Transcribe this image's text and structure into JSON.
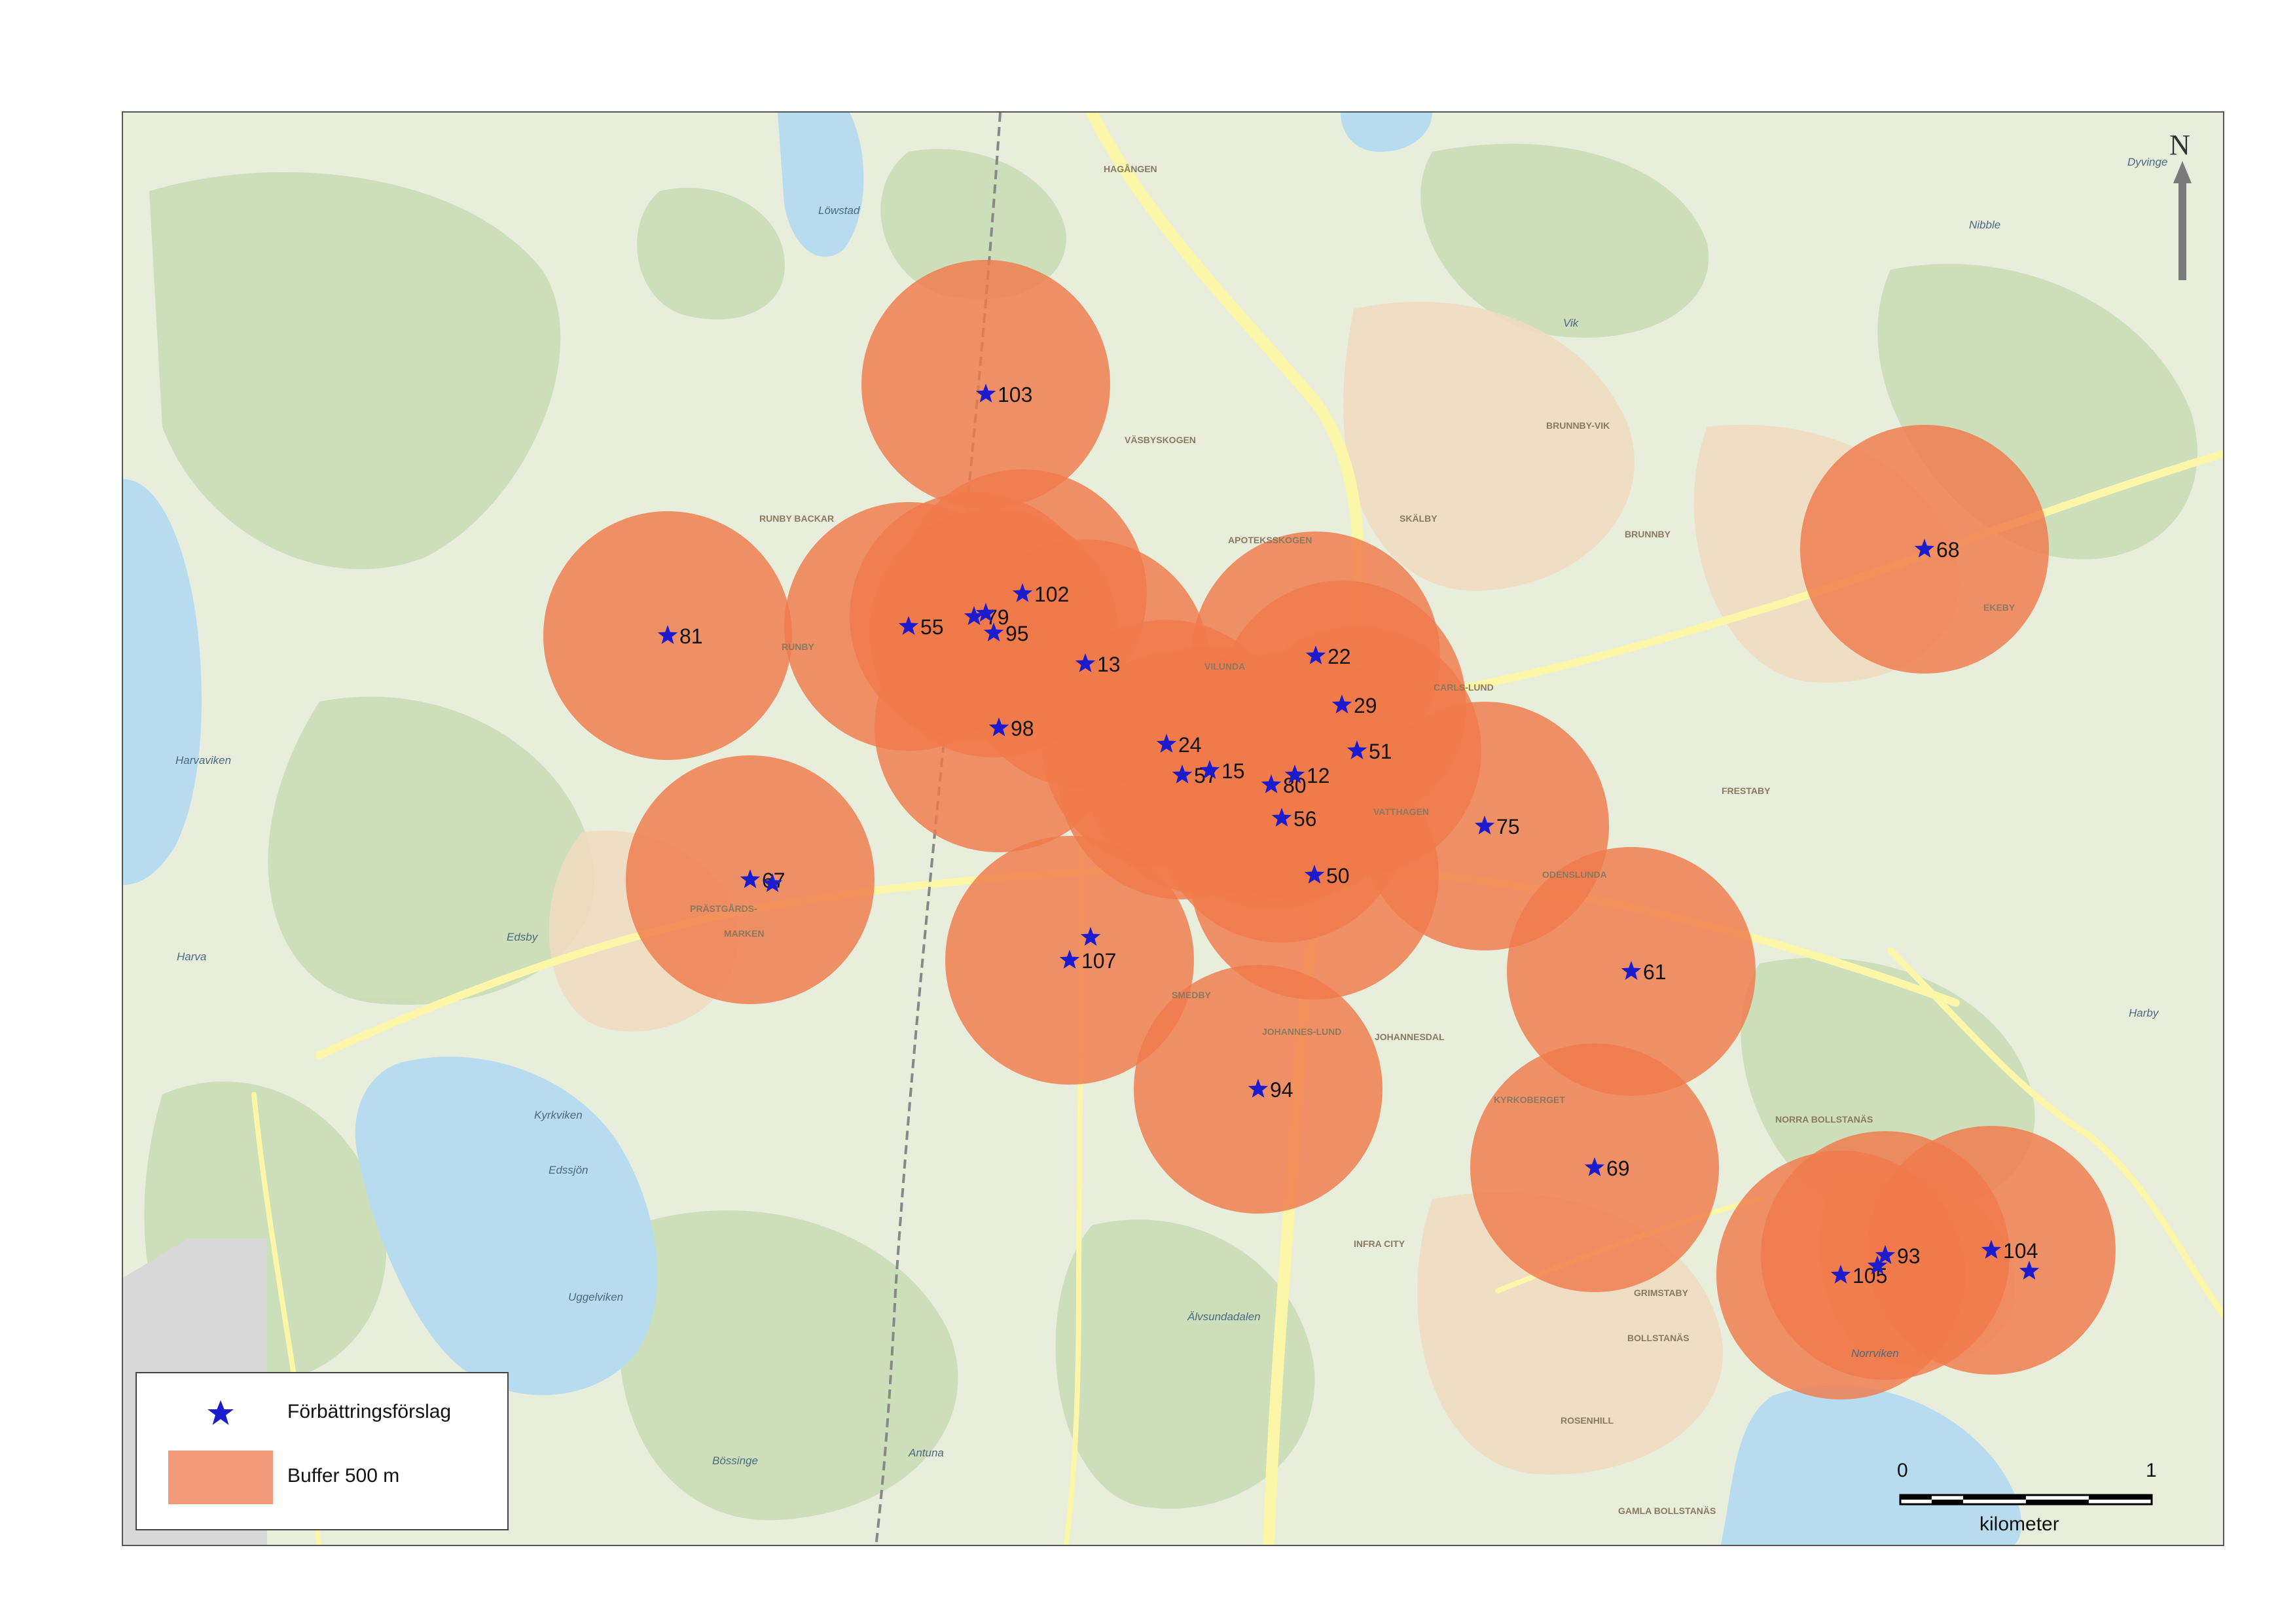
{
  "map": {
    "place_labels": [
      "HAGÅNGEN",
      "VÄSBYSKOGEN",
      "RUNBY BACKAR",
      "RUNBY",
      "APOTEKSSKOGEN",
      "VILUNDA",
      "SKÄLBY",
      "BRUNNBY",
      "BRUNNBY-VIK",
      "CARLS-LUND",
      "EKEBY",
      "FRESTABY",
      "VATTHAGEN",
      "ODENSLUNDA",
      "PRÄSTGÅRDS-",
      "MARKEN",
      "SMEDBY",
      "JOHANNES-LUND",
      "JOHANNESDAL",
      "KYRKOBERGET",
      "NORRA BOLLSTANÄS",
      "GRIMSTABY",
      "BOLLSTANÄS",
      "ROSENHILL",
      "GAMLA BOLLSTANÄS",
      "INFRA CITY",
      "Edssjön",
      "Harva",
      "Edsby",
      "Nibble",
      "Vik",
      "Löwstad",
      "Dyvinge",
      "Harby",
      "Kyrkviken",
      "Norrviken",
      "Uggelviken",
      "Älvsundadalen",
      "Bössinge",
      "Antuna",
      "Harvaviken"
    ],
    "buffers": [
      {
        "id": "103"
      },
      {
        "id": "55"
      },
      {
        "id": "102"
      },
      {
        "id": "95"
      },
      {
        "id": "79"
      },
      {
        "id": "13"
      },
      {
        "id": "98"
      },
      {
        "id": "81"
      },
      {
        "id": "67"
      },
      {
        "id": "107"
      },
      {
        "id": "22"
      },
      {
        "id": "29"
      },
      {
        "id": "24"
      },
      {
        "id": "57"
      },
      {
        "id": "15"
      },
      {
        "id": "80"
      },
      {
        "id": "12"
      },
      {
        "id": "56"
      },
      {
        "id": "51"
      },
      {
        "id": "50"
      },
      {
        "id": "75"
      },
      {
        "id": "61"
      },
      {
        "id": "69"
      },
      {
        "id": "94"
      },
      {
        "id": "68"
      },
      {
        "id": "93"
      },
      {
        "id": "105"
      },
      {
        "id": "104"
      }
    ],
    "markers": [
      {
        "label": "103"
      },
      {
        "label": "102"
      },
      {
        "label": "55"
      },
      {
        "label": "95"
      },
      {
        "label": "79"
      },
      {
        "label": "13"
      },
      {
        "label": "98"
      },
      {
        "label": "81"
      },
      {
        "label": "67"
      },
      {
        "label": "107"
      },
      {
        "label": "24"
      },
      {
        "label": "57"
      },
      {
        "label": "15"
      },
      {
        "label": "80"
      },
      {
        "label": "12"
      },
      {
        "label": "56"
      },
      {
        "label": "22"
      },
      {
        "label": "29"
      },
      {
        "label": "51"
      },
      {
        "label": "50"
      },
      {
        "label": "75"
      },
      {
        "label": "61"
      },
      {
        "label": "69"
      },
      {
        "label": "94"
      },
      {
        "label": "68"
      },
      {
        "label": "93"
      },
      {
        "label": "105"
      },
      {
        "label": "104"
      },
      {
        "label": ""
      },
      {
        "label": ""
      },
      {
        "label": ""
      },
      {
        "label": ""
      },
      {
        "label": ""
      }
    ],
    "colors": {
      "land": "#e8eddc",
      "forest": "#c9dcb6",
      "water": "#b8dcef",
      "urban": "#f0dcc0",
      "buffer": "#f07a4c",
      "marker": "#1c1ccf",
      "road": "#fbf6a8"
    }
  },
  "legend": {
    "marker_label": "Förbättringsförslag",
    "buffer_label": "Buffer 500 m"
  },
  "north_arrow": {
    "label": "N"
  },
  "scale_bar": {
    "start": "0",
    "end": "1",
    "unit": "kilometer"
  }
}
